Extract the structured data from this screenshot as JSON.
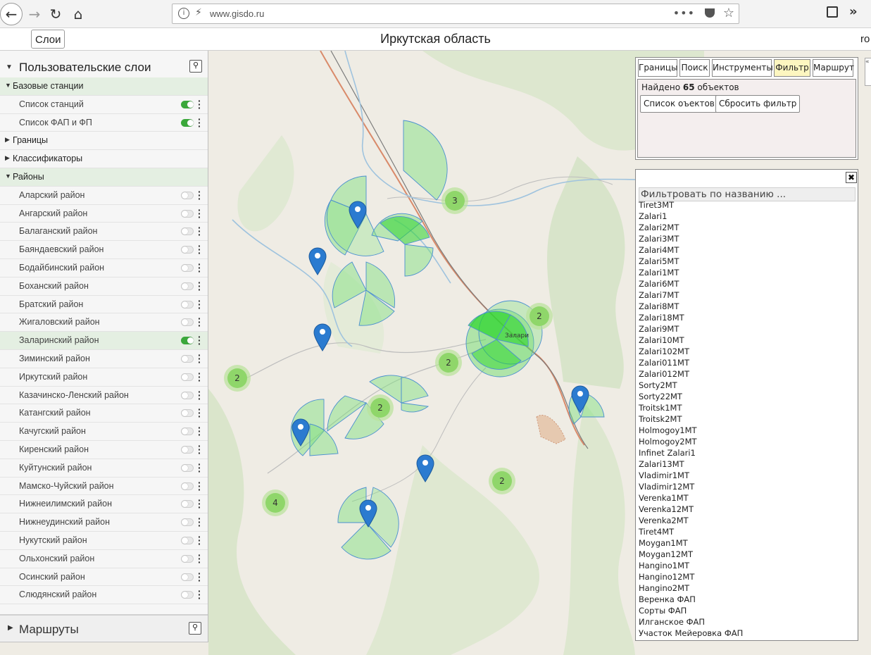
{
  "browser": {
    "url": "www.gisdo.ru",
    "icons": [
      "back-icon",
      "forward-icon",
      "reload-icon",
      "home-icon",
      "info-icon",
      "insecure-lock-icon",
      "page-actions-icon",
      "pocket-icon",
      "bookmark-star-icon",
      "reader-view-icon",
      "overflow-icon"
    ]
  },
  "appbar": {
    "layers_button": "Слои",
    "title": "Иркутская область",
    "user": "ro"
  },
  "sidebar": {
    "title": "Пользовательские слои",
    "footer_title": "Маршруты",
    "rows": [
      {
        "kind": "group",
        "expanded": true,
        "label": "Базовые станции"
      },
      {
        "kind": "item",
        "label": "Список станций",
        "on": true
      },
      {
        "kind": "item",
        "label": "Список ФАП и ФП",
        "on": true
      },
      {
        "kind": "collapsed",
        "expanded": false,
        "label": "Границы"
      },
      {
        "kind": "collapsed",
        "expanded": false,
        "label": "Классификаторы"
      },
      {
        "kind": "group",
        "expanded": true,
        "label": "Районы"
      },
      {
        "kind": "item",
        "label": "Аларский район",
        "on": false
      },
      {
        "kind": "item",
        "label": "Ангарский район",
        "on": false
      },
      {
        "kind": "item",
        "label": "Балаганский район",
        "on": false
      },
      {
        "kind": "item",
        "label": "Баяндаевский район",
        "on": false
      },
      {
        "kind": "item",
        "label": "Бодайбинский район",
        "on": false
      },
      {
        "kind": "item",
        "label": "Боханский район",
        "on": false
      },
      {
        "kind": "item",
        "label": "Братский район",
        "on": false
      },
      {
        "kind": "item",
        "label": "Жигаловский район",
        "on": false
      },
      {
        "kind": "item",
        "label": "Заларинский район",
        "on": true
      },
      {
        "kind": "item",
        "label": "Зиминский район",
        "on": false
      },
      {
        "kind": "item",
        "label": "Иркутский район",
        "on": false
      },
      {
        "kind": "item",
        "label": "Казачинско-Ленский район",
        "on": false
      },
      {
        "kind": "item",
        "label": "Катангский район",
        "on": false
      },
      {
        "kind": "item",
        "label": "Качугский район",
        "on": false
      },
      {
        "kind": "item",
        "label": "Киренский район",
        "on": false
      },
      {
        "kind": "item",
        "label": "Куйтунский район",
        "on": false
      },
      {
        "kind": "item",
        "label": "Мамско-Чуйский район",
        "on": false
      },
      {
        "kind": "item",
        "label": "Нижнеилимский район",
        "on": false
      },
      {
        "kind": "item",
        "label": "Нижнеудинский район",
        "on": false
      },
      {
        "kind": "item",
        "label": "Нукутский район",
        "on": false
      },
      {
        "kind": "item",
        "label": "Ольхонский район",
        "on": false
      },
      {
        "kind": "item",
        "label": "Осинский район",
        "on": false
      },
      {
        "kind": "item",
        "label": "Слюдянский район",
        "on": false
      }
    ]
  },
  "panel": {
    "tabs": [
      "Границы",
      "Поиск",
      "Инструменты",
      "Фильтр",
      "Маршрут"
    ],
    "active_tab": "Фильтр",
    "found_prefix": "Найдено ",
    "found_count": "65",
    "found_suffix": " объектов",
    "list_button": "Список оъектов",
    "reset_button": "Сбросить фильтр"
  },
  "list": {
    "filter_placeholder": "Фильтровать по названию ...",
    "items": [
      "Tiret3MT",
      "Zalari1",
      "Zalari2MT",
      "Zalari3MT",
      "Zalari4MT",
      "Zalari5MT",
      "Zalari1MT",
      "Zalari6MT",
      "Zalari7MT",
      "Zalari8MT",
      "Zalari18MT",
      "Zalari9MT",
      "Zalari10MT",
      "Zalari102MT",
      "Zalari011MT",
      "Zalari012MT",
      "Sorty2MT",
      "Sorty22MT",
      "Troitsk1MT",
      "Troitsk2MT",
      "Holmogoy1MT",
      "Holmogoy2MT",
      "Infinet Zalari1",
      "Zalari13MT",
      "Vladimir1MT",
      "Vladimir12MT",
      "Verenka1MT",
      "Verenka12MT",
      "Verenka2MT",
      "Tiret4MT",
      "Moygan1MT",
      "Moygan12MT",
      "Hangino1MT",
      "Hangino12MT",
      "Hangino2MT",
      "Веренка ФАП",
      "Сорты ФАП",
      "Илганское ФАП",
      "Участок Мейеровка ФАП"
    ]
  },
  "map": {
    "clusters": [
      "3",
      "2",
      "2",
      "2",
      "2",
      "2",
      "4"
    ],
    "town_label": "Залари",
    "colors": {
      "sector_fill": "#7be07b",
      "sector_stroke": "#4a8fd0",
      "marker": "#2b7bd0",
      "cluster": "#8fd66a"
    }
  }
}
